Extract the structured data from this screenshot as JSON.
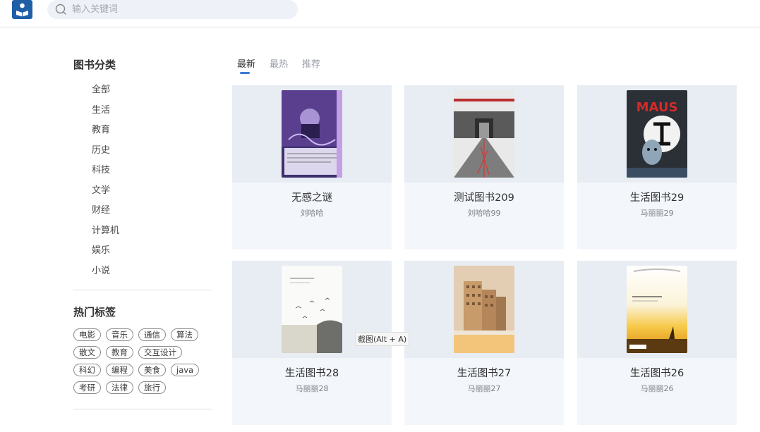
{
  "header": {
    "logo_icon": "reader-book-icon",
    "search": {
      "placeholder": "输入关键词",
      "value": "",
      "icon": "search-icon"
    }
  },
  "sidebar": {
    "category_title": "图书分类",
    "categories": [
      "全部",
      "生活",
      "教育",
      "历史",
      "科技",
      "文学",
      "财经",
      "计算机",
      "娱乐",
      "小说"
    ],
    "tags_title": "热门标签",
    "tags": [
      "电影",
      "音乐",
      "通信",
      "算法",
      "散文",
      "教育",
      "交互设计",
      "科幻",
      "编程",
      "美食",
      "java",
      "考研",
      "法律",
      "旅行"
    ]
  },
  "tabs": [
    {
      "label": "最新",
      "active": true
    },
    {
      "label": "最热",
      "active": false
    },
    {
      "label": "推荐",
      "active": false
    }
  ],
  "books": [
    {
      "title": "无感之谜",
      "author": "刘哈哈"
    },
    {
      "title": "测试图书209",
      "author": "刘哈哈99"
    },
    {
      "title": "生活图书29",
      "author": "马丽丽29"
    },
    {
      "title": "生活图书28",
      "author": "马丽丽28"
    },
    {
      "title": "生活图书27",
      "author": "马丽丽27"
    },
    {
      "title": "生活图书26",
      "author": "马丽丽26"
    }
  ],
  "tooltip": "截图(Alt + A)",
  "colors": {
    "accent": "#3a7bd5",
    "logo": "#1f5fa6",
    "card_bg": "#f3f6fa"
  }
}
